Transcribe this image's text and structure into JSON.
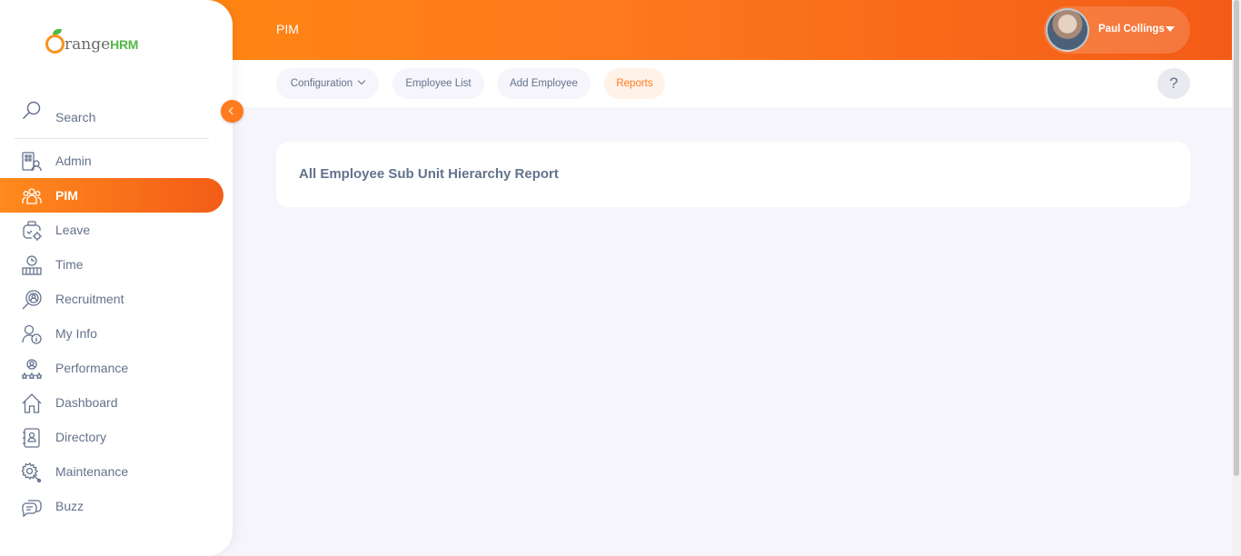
{
  "app": {
    "logo_text": "range",
    "logo_suffix": "HRM"
  },
  "topbar": {
    "module_title": "PIM",
    "user_name": "Paul Collings"
  },
  "subnav": {
    "tabs": [
      {
        "label": "Configuration",
        "has_dropdown": true,
        "active": false
      },
      {
        "label": "Employee List",
        "active": false
      },
      {
        "label": "Add Employee",
        "active": false
      },
      {
        "label": "Reports",
        "active": true
      }
    ],
    "help_label": "?"
  },
  "sidebar": {
    "search_label": "Search",
    "items": [
      {
        "label": "Admin",
        "icon": "admin-icon"
      },
      {
        "label": "PIM",
        "icon": "pim-icon",
        "active": true
      },
      {
        "label": "Leave",
        "icon": "leave-icon"
      },
      {
        "label": "Time",
        "icon": "time-icon"
      },
      {
        "label": "Recruitment",
        "icon": "recruitment-icon"
      },
      {
        "label": "My Info",
        "icon": "my-info-icon"
      },
      {
        "label": "Performance",
        "icon": "performance-icon"
      },
      {
        "label": "Dashboard",
        "icon": "dashboard-icon"
      },
      {
        "label": "Directory",
        "icon": "directory-icon"
      },
      {
        "label": "Maintenance",
        "icon": "maintenance-icon"
      },
      {
        "label": "Buzz",
        "icon": "buzz-icon"
      }
    ]
  },
  "main": {
    "report_title": "All Employee Sub Unit Hierarchy Report"
  },
  "colors": {
    "accent": "#ff7b1d",
    "text": "#64728c",
    "background": "#f6f5fb",
    "brand_green": "#52b848"
  }
}
